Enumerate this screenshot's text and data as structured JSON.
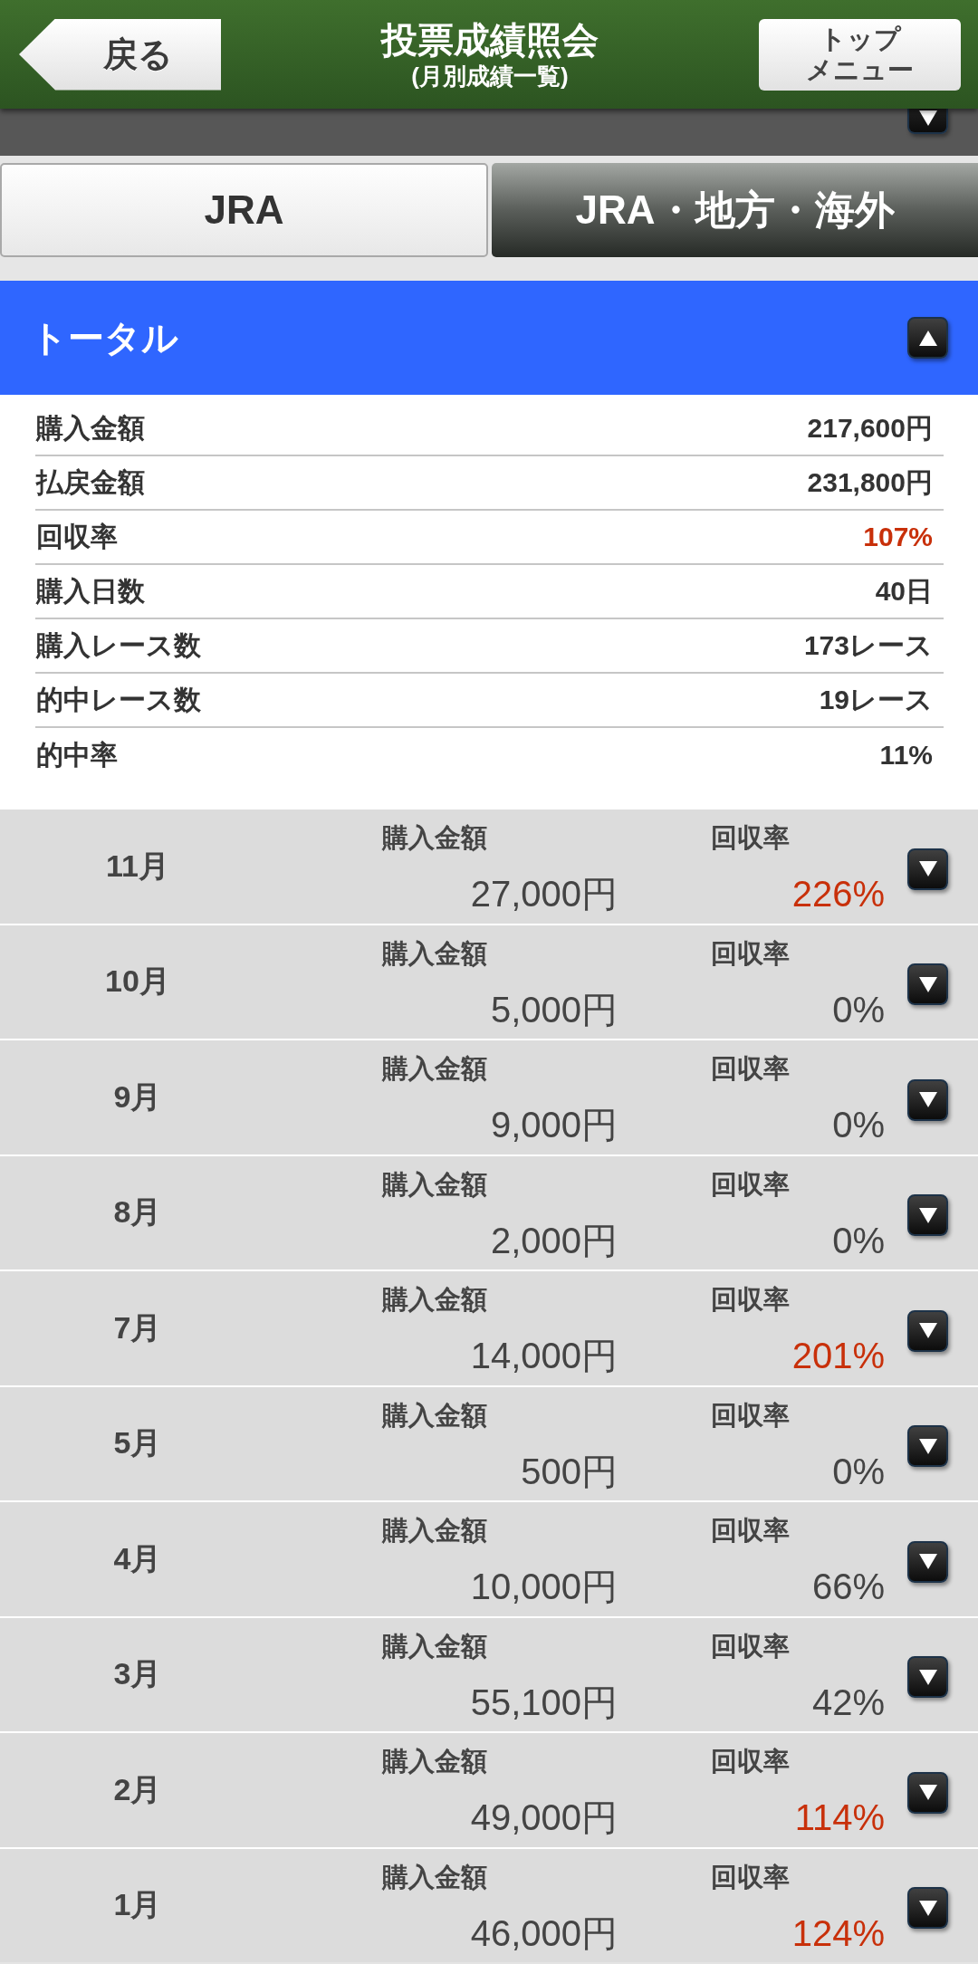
{
  "header": {
    "back_button": "戻る",
    "title": "投票成績照会",
    "subtitle": "(月別成績一覧)",
    "top_menu_button": [
      "トップ",
      "メニュー"
    ]
  },
  "tabs": [
    {
      "label": "JRA",
      "selected": false
    },
    {
      "label": "JRA・地方・海外",
      "selected": true
    }
  ],
  "total": {
    "title": "トータル",
    "expanded": true,
    "rows": [
      {
        "label": "購入金額",
        "value": "217,600円",
        "highlight": false
      },
      {
        "label": "払戻金額",
        "value": "231,800円",
        "highlight": false
      },
      {
        "label": "回収率",
        "value": "107%",
        "highlight": true
      },
      {
        "label": "購入日数",
        "value": "40日",
        "highlight": false
      },
      {
        "label": "購入レース数",
        "value": "173レース",
        "highlight": false
      },
      {
        "label": "的中レース数",
        "value": "19レース",
        "highlight": false
      },
      {
        "label": "的中率",
        "value": "11%",
        "highlight": false
      }
    ]
  },
  "months": [
    {
      "month": "11月",
      "amount_label": "購入金額",
      "amount": "27,000円",
      "rate_label": "回収率",
      "rate": "226%",
      "highlight": true,
      "expanded": false
    },
    {
      "month": "10月",
      "amount_label": "購入金額",
      "amount": "5,000円",
      "rate_label": "回収率",
      "rate": "0%",
      "highlight": false,
      "expanded": false
    },
    {
      "month": "9月",
      "amount_label": "購入金額",
      "amount": "9,000円",
      "rate_label": "回収率",
      "rate": "0%",
      "highlight": false,
      "expanded": false
    },
    {
      "month": "8月",
      "amount_label": "購入金額",
      "amount": "2,000円",
      "rate_label": "回収率",
      "rate": "0%",
      "highlight": false,
      "expanded": false
    },
    {
      "month": "7月",
      "amount_label": "購入金額",
      "amount": "14,000円",
      "rate_label": "回収率",
      "rate": "201%",
      "highlight": true,
      "expanded": false
    },
    {
      "month": "5月",
      "amount_label": "購入金額",
      "amount": "500円",
      "rate_label": "回収率",
      "rate": "0%",
      "highlight": false,
      "expanded": false
    },
    {
      "month": "4月",
      "amount_label": "購入金額",
      "amount": "10,000円",
      "rate_label": "回収率",
      "rate": "66%",
      "highlight": false,
      "expanded": false
    },
    {
      "month": "3月",
      "amount_label": "購入金額",
      "amount": "55,100円",
      "rate_label": "回収率",
      "rate": "42%",
      "highlight": false,
      "expanded": false
    },
    {
      "month": "2月",
      "amount_label": "購入金額",
      "amount": "49,000円",
      "rate_label": "回収率",
      "rate": "114%",
      "highlight": true,
      "expanded": false
    },
    {
      "month": "1月",
      "amount_label": "購入金額",
      "amount": "46,000円",
      "rate_label": "回収率",
      "rate": "124%",
      "highlight": true,
      "expanded": false
    }
  ]
}
